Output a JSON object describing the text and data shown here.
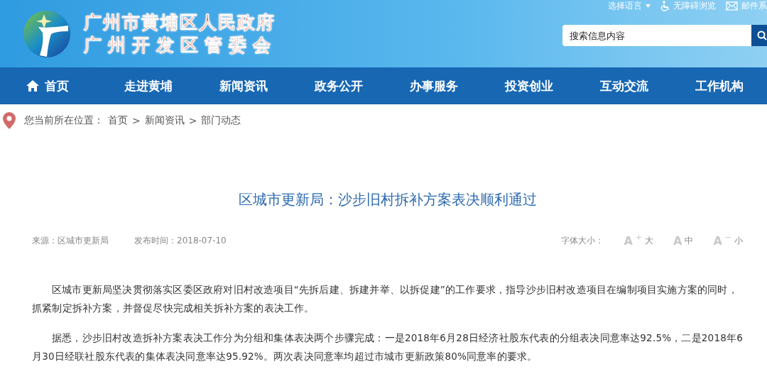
{
  "header": {
    "title_lines": [
      "广州市黄埔区人民政府",
      "广州开发区管委会"
    ],
    "top_links": [
      {
        "kind": "language",
        "label": "选择语言"
      },
      {
        "kind": "accessibility",
        "label": "无障碍浏览"
      },
      {
        "kind": "mail",
        "label": "邮件系"
      }
    ],
    "search": {
      "placeholder": "搜索信息内容"
    }
  },
  "nav": [
    {
      "label": "首页",
      "kind": "home"
    },
    {
      "label": "走进黄埔",
      "kind": "plain"
    },
    {
      "label": "新闻资讯",
      "kind": "plain"
    },
    {
      "label": "政务公开",
      "kind": "plain"
    },
    {
      "label": "办事服务",
      "kind": "plain"
    },
    {
      "label": "投资创业",
      "kind": "plain"
    },
    {
      "label": "互动交流",
      "kind": "plain"
    },
    {
      "label": "工作机构",
      "kind": "plain"
    }
  ],
  "breadcrumb": {
    "prefix": "您当前所在位置：",
    "items": [
      "首页",
      "新闻资讯",
      "部门动态"
    ],
    "separator": ">"
  },
  "article": {
    "title": "区城市更新局：沙步旧村拆补方案表决顺利通过",
    "source": "来源：区城市更新局",
    "date": "发布时间：2018-07-10",
    "font_size": {
      "label": "字体大小：",
      "options": [
        {
          "glyph": "A",
          "sign": "+",
          "label": "大"
        },
        {
          "glyph": "A",
          "label": "中"
        },
        {
          "glyph": "A",
          "sign": "−",
          "label": "小"
        }
      ]
    },
    "paragraphs": [
      "区城市更新局坚决贯彻落实区委区政府对旧村改造项目“先拆后建、拆建并举、以拆促建”的工作要求，指导沙步旧村改造项目在编制项目实施方案的同时，抓紧制定拆补方案，并督促尽快完成相关拆补方案的表决工作。",
      "据悉，沙步旧村改造拆补方案表决工作分为分组和集体表决两个步骤完成：一是2018年6月28日经济社股东代表的分组表决同意率达92.5%，二是2018年6月30日经联社股东代表的集体表决同意率达95.92%。两次表决同意率均超过市城市更新政策80%同意率的要求。"
    ]
  }
}
